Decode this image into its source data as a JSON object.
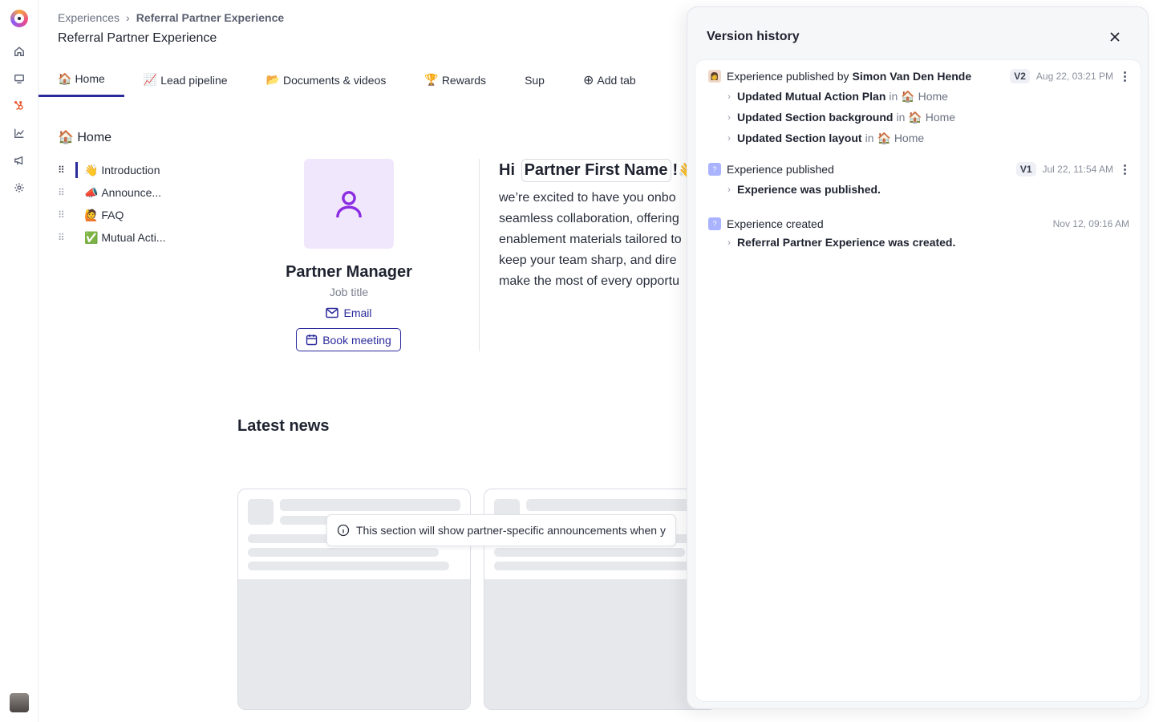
{
  "nav": {
    "items": [
      {
        "name": "home-icon"
      },
      {
        "name": "monitor-icon"
      },
      {
        "name": "hubspot-icon"
      },
      {
        "name": "analytics-icon"
      },
      {
        "name": "megaphone-icon"
      },
      {
        "name": "gear-icon"
      }
    ],
    "accent": "#e8562e"
  },
  "breadcrumb": {
    "parent": "Experiences",
    "separator": "›",
    "current": "Referral Partner Experience"
  },
  "page_title": "Referral Partner Experience",
  "tabs": [
    {
      "emoji": "🏠",
      "label": "Home",
      "active": true
    },
    {
      "emoji": "📈",
      "label": "Lead pipeline"
    },
    {
      "emoji": "📂",
      "label": "Documents & videos"
    },
    {
      "emoji": "🏆",
      "label": "Rewards"
    },
    {
      "emoji": "",
      "label": "Sup"
    },
    {
      "emoji": "⊕",
      "label": "Add tab"
    }
  ],
  "home_heading": {
    "emoji": "🏠",
    "label": "Home"
  },
  "sections": [
    {
      "emoji": "👋",
      "label": "Introduction",
      "active": true
    },
    {
      "emoji": "📣",
      "label": "Announce..."
    },
    {
      "emoji": "🙋",
      "label": "FAQ"
    },
    {
      "emoji": "✅",
      "label": "Mutual Acti..."
    }
  ],
  "manager": {
    "name": "Partner Manager",
    "job_title": "Job title",
    "email_label": "Email",
    "book_label": "Book meeting"
  },
  "greeting": {
    "hi": "Hi",
    "placeholder": "Partner First Name",
    "exclaim": "!",
    "wave": "👋"
  },
  "intro_lines": [
    "we’re excited to have you onbo",
    "seamless collaboration, offering",
    "enablement materials tailored to",
    "keep your team sharp, and dire",
    "make the most of every opportu"
  ],
  "news": {
    "heading": "Latest news",
    "tooltip": "This section will show partner-specific announcements when y"
  },
  "version_history": {
    "title": "Version history",
    "entries": [
      {
        "icon": "user",
        "text": "Experience published by",
        "author": "Simon Van Den Hende",
        "version": "V2",
        "date": "Aug 22, 03:21 PM",
        "changes": [
          {
            "action": "Updated Mutual Action Plan",
            "in": "in",
            "loc_emoji": "🏠",
            "loc": "Home"
          },
          {
            "action": "Updated Section background",
            "in": "in",
            "loc_emoji": "🏠",
            "loc": "Home"
          },
          {
            "action": "Updated Section layout",
            "in": "in",
            "loc_emoji": "🏠",
            "loc": "Home"
          }
        ]
      },
      {
        "icon": "system",
        "text": "Experience published",
        "version": "V1",
        "date": "Jul 22, 11:54 AM",
        "changes": [
          {
            "action": "Experience was published."
          }
        ]
      },
      {
        "icon": "system",
        "text": "Experience created",
        "date": "Nov 12, 09:16 AM",
        "changes": [
          {
            "action": "Referral Partner Experience was created."
          }
        ]
      }
    ]
  },
  "colors": {
    "primary": "#2b2a9b",
    "avatar_bg": "#f1e7fd",
    "avatar_icon": "#8b2ce2"
  }
}
